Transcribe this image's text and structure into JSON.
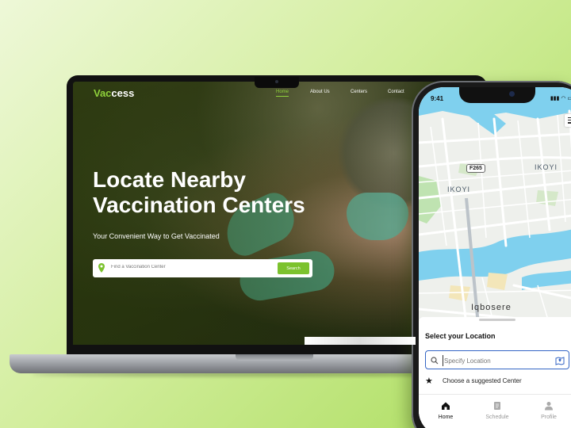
{
  "laptop": {
    "logo_prefix": "Vac",
    "logo_suffix": "cess",
    "nav": [
      {
        "label": "Home",
        "active": true
      },
      {
        "label": "About Us",
        "active": false
      },
      {
        "label": "Centers",
        "active": false
      },
      {
        "label": "Contact",
        "active": false
      }
    ],
    "hero_title_line1": "Locate Nearby",
    "hero_title_line2": "Vaccination Centers",
    "hero_subtitle": "Your Convenient Way to Get Vaccinated",
    "search": {
      "placeholder": "Find a Vaccination Center",
      "button_label": "Search",
      "icon": "location-pin-icon"
    }
  },
  "phone": {
    "status_time": "9:41",
    "status_icons": "▮▮▮ ◠ ▭",
    "map": {
      "labels": [
        "IKOYI",
        "IKOYI",
        "Iqbosere"
      ],
      "road_badge": "F265",
      "menu_icon": "hamburger-menu-icon"
    },
    "sheet": {
      "title": "Select your Location",
      "input_placeholder": "Specify Location",
      "suggest_label": "Choose a suggested Center"
    },
    "tabs": [
      {
        "label": "Home",
        "icon": "home-icon",
        "active": true
      },
      {
        "label": "Schedule",
        "icon": "schedule-icon",
        "active": false
      },
      {
        "label": "Profile",
        "icon": "profile-icon",
        "active": false
      }
    ]
  },
  "colors": {
    "brand_green": "#8fd13b",
    "search_button": "#7cc22e",
    "map_water": "#7fd0ee",
    "map_land": "#eef0ec",
    "input_focus": "#3566c5"
  }
}
